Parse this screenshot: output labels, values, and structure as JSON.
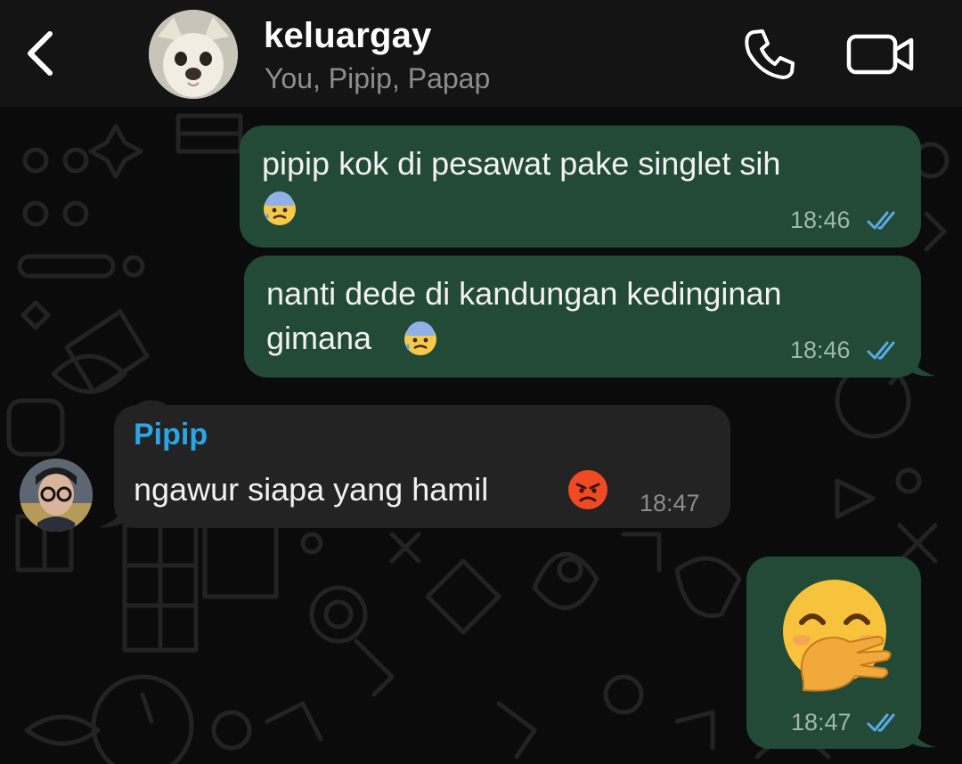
{
  "header": {
    "title": "keluargay",
    "members": "You, Pipip, Papap"
  },
  "messages": [
    {
      "direction": "outgoing",
      "text_line1": "pipip kok di pesawat pake singlet sih",
      "emoji": "anxious-face-with-sweat",
      "time": "18:46",
      "status": "read"
    },
    {
      "direction": "outgoing",
      "text_line1": "nanti dede di kandungan kedinginan",
      "text_line2": "gimana",
      "emoji": "anxious-face-with-sweat",
      "time": "18:46",
      "status": "read"
    },
    {
      "direction": "incoming",
      "sender": "Pipip",
      "text": "ngawur siapa yang hamil",
      "emoji": "pouting-face",
      "time": "18:47"
    },
    {
      "direction": "outgoing",
      "emoji": "face-with-hand-over-mouth",
      "time": "18:47",
      "status": "read"
    }
  ],
  "colors": {
    "background": "#0b0b0b",
    "header": "#141414",
    "outgoing_bubble": "#234a37",
    "incoming_bubble": "#232323",
    "sender_name": "#2aa6e5",
    "read_ticks": "#5aa9e6"
  },
  "icons": {
    "back": "chevron-left-icon",
    "call": "phone-icon",
    "video": "video-camera-icon"
  }
}
